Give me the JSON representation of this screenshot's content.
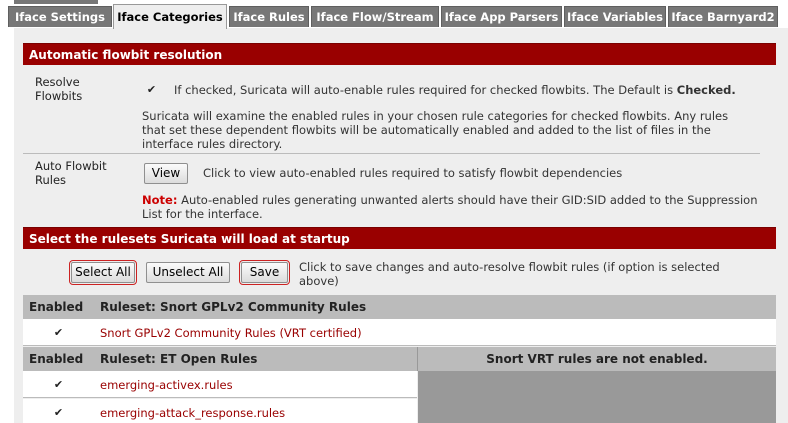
{
  "tabs": [
    {
      "label": "Iface Settings",
      "active": false
    },
    {
      "label": "Iface Categories",
      "active": true
    },
    {
      "label": "Iface Rules",
      "active": false
    },
    {
      "label": "Iface Flow/Stream",
      "active": false
    },
    {
      "label": "Iface App Parsers",
      "active": false
    },
    {
      "label": "Iface Variables",
      "active": false
    },
    {
      "label": "Iface Barnyard2",
      "active": false
    }
  ],
  "flowbit": {
    "header": "Automatic flowbit resolution",
    "resolve_label": "Resolve Flowbits",
    "resolve_checked": true,
    "resolve_hint_prefix": "If checked, Suricata will auto-enable rules required for checked flowbits.  The Default is ",
    "resolve_hint_bold": "Checked.",
    "resolve_desc": "Suricata will examine the enabled rules in your chosen rule categories for checked flowbits. Any rules that set these dependent flowbits will be automatically enabled and added to the list of files in the interface rules directory.",
    "auto_label": "Auto Flowbit Rules",
    "view_button": "View",
    "view_hint": "Click to view auto-enabled rules required to satisfy flowbit dependencies",
    "note_label": "Note:",
    "note_text": " Auto-enabled rules generating unwanted alerts should have their GID:SID added to the Suppression List for the interface."
  },
  "rulesets": {
    "header": "Select the rulesets Suricata will load at startup",
    "select_all": "Select All",
    "unselect_all": "Unselect All",
    "save": "Save",
    "save_hint": "Click to save changes and auto-resolve flowbit rules (if option is selected above)"
  },
  "gplv2_table": {
    "col_enabled": "Enabled",
    "col_ruleset": "Ruleset: Snort GPLv2 Community Rules",
    "rows": [
      {
        "checked": true,
        "name": "Snort GPLv2 Community Rules (VRT certified)"
      }
    ]
  },
  "et_table": {
    "col_enabled": "Enabled",
    "col_ruleset": "Ruleset: ET Open Rules",
    "vrt_notice": "Snort VRT rules are not enabled.",
    "rows": [
      {
        "checked": true,
        "name": "emerging-activex.rules"
      },
      {
        "checked": true,
        "name": "emerging-attack_response.rules"
      }
    ]
  }
}
